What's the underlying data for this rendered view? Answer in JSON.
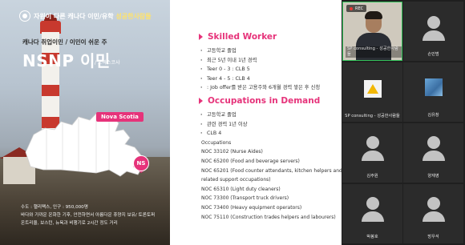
{
  "slide": {
    "brand_prefix": "자원이 다른 캐나다 이민/유학",
    "brand_name": "성공한사람들",
    "subtitle": "캐나다 취업이민 / 이민이 쉬운 주",
    "title": "NSNP 이민",
    "title_sub": "/ 노바스코샤",
    "province_tag": "Nova Scotia",
    "province_badge": "NS",
    "facts": [
      "수도 : 핼리팩스, 인구 : 950,000명",
      "바다와 가까운 온화한 기후, 안전하면서 아름다운 휴양지 보유/ 토론토퍼",
      "온트리올, 보스턴, 뉴욕과 비행기로 2시간 정도 거리"
    ],
    "sections": [
      {
        "title": "Skilled Worker",
        "bullets": [
          "고등학교 졸업",
          "최근 5년 이내 1년 경력",
          "Teer 0 - 3 : CLB 5",
          "Teer 4 - 5 : CLB 4",
          ": Job offer를 받은 고용주와 6개월 경력 쌓은 후 신청"
        ]
      },
      {
        "title": "Occupations in Demand",
        "bullets": [
          "고등학교 졸업",
          "관련 경력 1년 이상",
          "CLB 4"
        ],
        "list_heading": "Occupations",
        "occupations": [
          "NOC 33102 (Nurse Aides)",
          "NOC 65200 (Food and beverage servers)",
          "NOC 65201 (Food counter attendants, kitchen helpers and",
          "related support occupations)",
          "NOC 65310 (Light duty cleaners)",
          "NOC 73300 (Transport truck drivers)",
          "NOC 73400 (Heavy equipment operators)",
          "NOC 75110 (Construction trades helpers and labourers)"
        ]
      }
    ]
  },
  "recording": {
    "label": "REC"
  },
  "participants": [
    {
      "name": "SP consulting - 성공한사람들",
      "type": "video"
    },
    {
      "name": "손민범",
      "type": "avatar"
    },
    {
      "name": "SP consulting - 성공한사람들",
      "type": "logo"
    },
    {
      "name": "김유창",
      "type": "thumbnail"
    },
    {
      "name": "김주원",
      "type": "avatar"
    },
    {
      "name": "양재영",
      "type": "avatar"
    },
    {
      "name": "박봉호",
      "type": "avatar"
    },
    {
      "name": "방우석",
      "type": "avatar"
    }
  ],
  "colors": {
    "accent": "#e6337a",
    "active_speaker": "#33c35a",
    "background": "#1f1f1f"
  }
}
